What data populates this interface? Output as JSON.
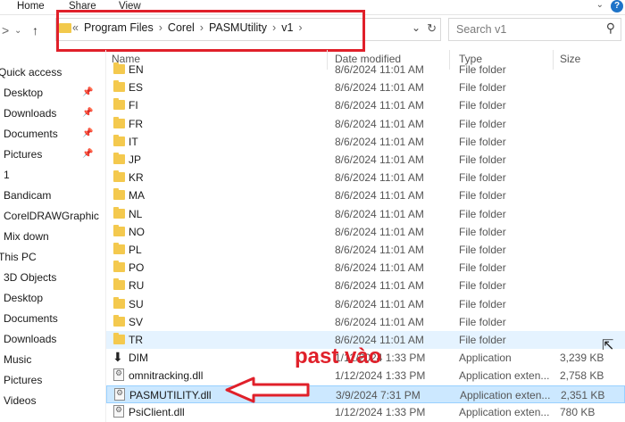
{
  "ribbon": {
    "tabs": [
      "Home",
      "Share",
      "View"
    ]
  },
  "address": {
    "prefix": "«",
    "crumbs": [
      "Program Files",
      "Corel",
      "PASMUtility",
      "v1"
    ]
  },
  "search": {
    "placeholder": "Search v1"
  },
  "sidebar": {
    "items": [
      {
        "label": "Quick access",
        "head": true
      },
      {
        "label": "Desktop",
        "pin": true
      },
      {
        "label": "Downloads",
        "pin": true
      },
      {
        "label": "Documents",
        "pin": true
      },
      {
        "label": "Pictures",
        "pin": true
      },
      {
        "label": "1"
      },
      {
        "label": "Bandicam"
      },
      {
        "label": "CorelDRAWGraphic"
      },
      {
        "label": "Mix down"
      },
      {
        "label": "This PC",
        "head": true
      },
      {
        "label": "3D Objects"
      },
      {
        "label": "Desktop"
      },
      {
        "label": "Documents"
      },
      {
        "label": "Downloads"
      },
      {
        "label": "Music"
      },
      {
        "label": "Pictures"
      },
      {
        "label": "Videos"
      }
    ]
  },
  "columns": {
    "name": "Name",
    "date": "Date modified",
    "type": "Type",
    "size": "Size"
  },
  "rows": [
    {
      "name": "EN",
      "date": "8/6/2024 11:01 AM",
      "type": "File folder",
      "size": "",
      "icon": "folder"
    },
    {
      "name": "ES",
      "date": "8/6/2024 11:01 AM",
      "type": "File folder",
      "size": "",
      "icon": "folder"
    },
    {
      "name": "FI",
      "date": "8/6/2024 11:01 AM",
      "type": "File folder",
      "size": "",
      "icon": "folder"
    },
    {
      "name": "FR",
      "date": "8/6/2024 11:01 AM",
      "type": "File folder",
      "size": "",
      "icon": "folder"
    },
    {
      "name": "IT",
      "date": "8/6/2024 11:01 AM",
      "type": "File folder",
      "size": "",
      "icon": "folder"
    },
    {
      "name": "JP",
      "date": "8/6/2024 11:01 AM",
      "type": "File folder",
      "size": "",
      "icon": "folder"
    },
    {
      "name": "KR",
      "date": "8/6/2024 11:01 AM",
      "type": "File folder",
      "size": "",
      "icon": "folder"
    },
    {
      "name": "MA",
      "date": "8/6/2024 11:01 AM",
      "type": "File folder",
      "size": "",
      "icon": "folder"
    },
    {
      "name": "NL",
      "date": "8/6/2024 11:01 AM",
      "type": "File folder",
      "size": "",
      "icon": "folder"
    },
    {
      "name": "NO",
      "date": "8/6/2024 11:01 AM",
      "type": "File folder",
      "size": "",
      "icon": "folder"
    },
    {
      "name": "PL",
      "date": "8/6/2024 11:01 AM",
      "type": "File folder",
      "size": "",
      "icon": "folder"
    },
    {
      "name": "PO",
      "date": "8/6/2024 11:01 AM",
      "type": "File folder",
      "size": "",
      "icon": "folder"
    },
    {
      "name": "RU",
      "date": "8/6/2024 11:01 AM",
      "type": "File folder",
      "size": "",
      "icon": "folder"
    },
    {
      "name": "SU",
      "date": "8/6/2024 11:01 AM",
      "type": "File folder",
      "size": "",
      "icon": "folder"
    },
    {
      "name": "SV",
      "date": "8/6/2024 11:01 AM",
      "type": "File folder",
      "size": "",
      "icon": "folder"
    },
    {
      "name": "TR",
      "date": "8/6/2024 11:01 AM",
      "type": "File folder",
      "size": "",
      "icon": "folder",
      "state": "hover"
    },
    {
      "name": "DIM",
      "date": "1/12/2024 1:33 PM",
      "type": "Application",
      "size": "3,239 KB",
      "icon": "app"
    },
    {
      "name": "omnitracking.dll",
      "date": "1/12/2024 1:33 PM",
      "type": "Application exten...",
      "size": "2,758 KB",
      "icon": "dll"
    },
    {
      "name": "PASMUTILITY.dll",
      "date": "3/9/2024 7:31 PM",
      "type": "Application exten...",
      "size": "2,351 KB",
      "icon": "dll",
      "state": "selected"
    },
    {
      "name": "PsiClient.dll",
      "date": "1/12/2024 1:33 PM",
      "type": "Application exten...",
      "size": "780 KB",
      "icon": "dll"
    }
  ],
  "annotation": {
    "text": "past vào",
    "color": "#e0202a"
  }
}
